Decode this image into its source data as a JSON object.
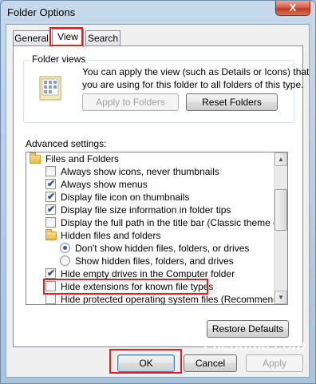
{
  "window": {
    "title": "Folder Options",
    "close_glyph": "X"
  },
  "tabs": [
    {
      "label": "General"
    },
    {
      "label": "View"
    },
    {
      "label": "Search"
    }
  ],
  "folder_views": {
    "title": "Folder views",
    "description_line1": "You can apply the view (such as Details or Icons) that",
    "description_line2": "you are using for this folder to all folders of this type.",
    "apply_label": "Apply to Folders",
    "reset_label": "Reset Folders"
  },
  "advanced": {
    "title": "Advanced settings:",
    "items": [
      {
        "type": "folder",
        "label": "Files and Folders"
      },
      {
        "type": "checkbox",
        "checked": false,
        "label": "Always show icons, never thumbnails"
      },
      {
        "type": "checkbox",
        "checked": true,
        "label": "Always show menus"
      },
      {
        "type": "checkbox",
        "checked": true,
        "label": "Display file icon on thumbnails"
      },
      {
        "type": "checkbox",
        "checked": true,
        "label": "Display file size information in folder tips"
      },
      {
        "type": "checkbox",
        "checked": false,
        "label": "Display the full path in the title bar (Classic theme only)"
      },
      {
        "type": "folder",
        "label": "Hidden files and folders"
      },
      {
        "type": "radio",
        "checked": true,
        "label": "Don't show hidden files, folders, or drives"
      },
      {
        "type": "radio",
        "checked": false,
        "label": "Show hidden files, folders, and drives"
      },
      {
        "type": "checkbox",
        "checked": true,
        "label": "Hide empty drives in the Computer folder"
      },
      {
        "type": "checkbox",
        "checked": false,
        "label": "Hide extensions for known file types"
      },
      {
        "type": "checkbox",
        "checked": false,
        "label": "Hide protected operating system files (Recommended)"
      }
    ],
    "check_glyph": "✔",
    "scroll_up": "▲",
    "scroll_down": "▼"
  },
  "restore_label": "Restore Defaults",
  "footer": {
    "ok_label": "OK",
    "cancel_label": "Cancel",
    "apply_label": "Apply"
  },
  "watermark": "Filepuma.com",
  "colors": {
    "highlight_box": "#e02020"
  }
}
